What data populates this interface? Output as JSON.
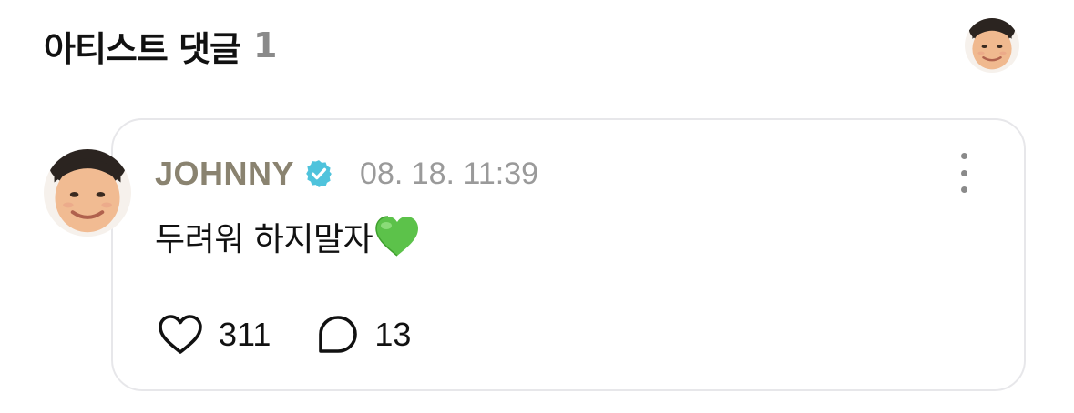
{
  "section": {
    "title": "아티스트 댓글",
    "count": "1"
  },
  "comment": {
    "author": "JOHNNY",
    "verified": true,
    "timestamp": "08. 18. 11:39",
    "text": "두려워 하지말자",
    "emoji": "green-heart",
    "likes": "311",
    "replies": "13"
  },
  "colors": {
    "title": "#111111",
    "count": "#8a8a8a",
    "author": "#8a8370",
    "timestamp": "#9a9a9a",
    "verified_badge": "#4fc3dc",
    "card_border": "#e7e7ea",
    "emoji_heart": "#5cc24a"
  },
  "icons": {
    "verified": "verified-badge-icon",
    "more": "more-vertical-icon",
    "like": "heart-outline-icon",
    "reply": "speech-bubble-icon"
  }
}
